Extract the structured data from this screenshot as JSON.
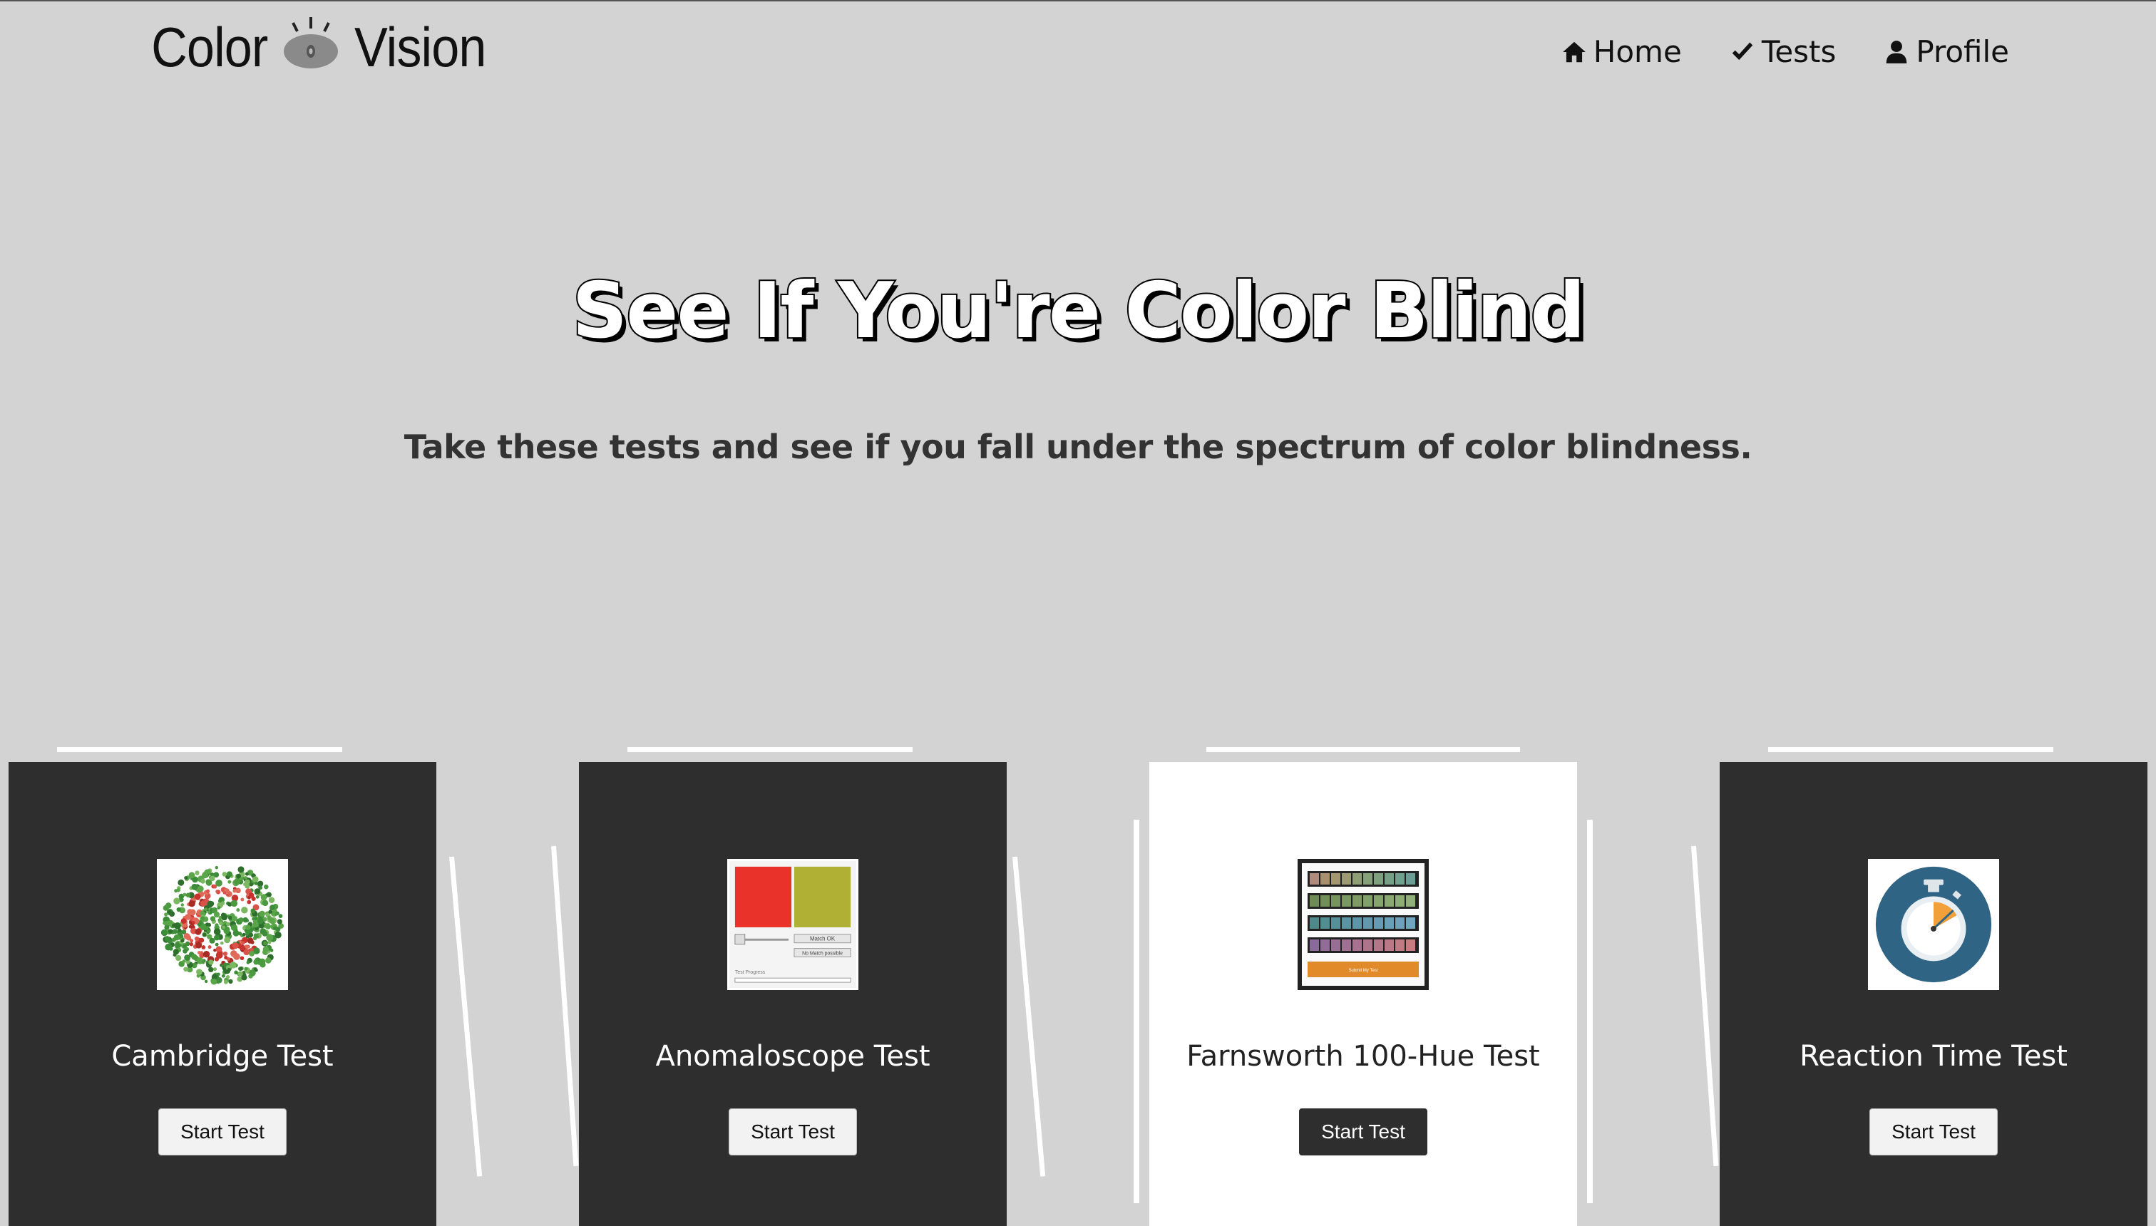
{
  "logo": {
    "left_word": "Color",
    "right_word": "Vision"
  },
  "nav": [
    {
      "label": "Home",
      "icon": "home-icon"
    },
    {
      "label": "Tests",
      "icon": "check-icon"
    },
    {
      "label": "Profile",
      "icon": "user-icon"
    }
  ],
  "hero": {
    "title": "See If You're Color Blind",
    "subtitle": "Take these tests and see if you fall under the spectrum of color blindness."
  },
  "cards": [
    {
      "title": "Cambridge Test",
      "button": "Start Test",
      "thumb": "ishihara-plate-thumbnail"
    },
    {
      "title": "Anomaloscope Test",
      "button": "Start Test",
      "thumb": "anomaloscope-thumbnail"
    },
    {
      "title": "Farnsworth 100-Hue Test",
      "button": "Start Test",
      "thumb": "hue-test-thumbnail"
    },
    {
      "title": "Reaction Time Test",
      "button": "Start Test",
      "thumb": "stopwatch-thumbnail"
    }
  ],
  "anomaloscope_thumb": {
    "match_label": "Match OK",
    "no_match_label": "No Match possible",
    "progress_label": "Test Progress"
  },
  "hue_thumb": {
    "button_label": "Submit My Test"
  },
  "colors": {
    "background": "#d3d3d3",
    "card_dark": "#2e2e2e",
    "card_light": "#ffffff",
    "accent_red": "#e8322a",
    "accent_olive": "#b0b034",
    "stopwatch_blue": "#2f6484"
  }
}
